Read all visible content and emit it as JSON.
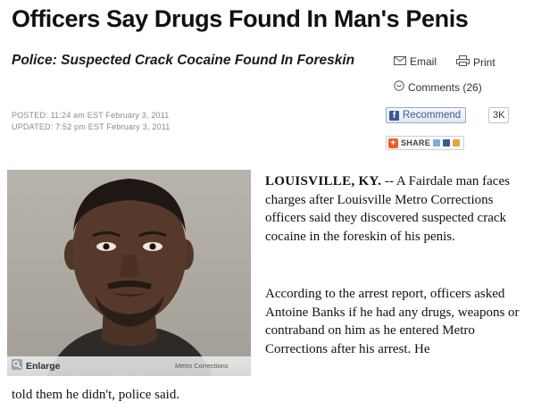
{
  "article": {
    "headline": "Officers Say Drugs Found In Man's Penis",
    "subheadline": "Police: Suspected Crack Cocaine Found In Foreskin",
    "posted": "POSTED: 11:24 am EST February 3, 2011",
    "updated": "UPDATED: 7:52 pm EST February 3, 2011",
    "dateline": "LOUISVILLE, KY.",
    "paragraph1_rest": " -- A Fairdale man faces charges after Louisville Metro Corrections officers said they discovered suspected crack cocaine in the foreskin of his penis.",
    "paragraph2": "According to the arrest report, officers asked Antoine Banks if he had any drugs, weapons or contraband on him as he entered Metro Corrections after his arrest. He",
    "paragraph2_continued": "told them he didn't, police said."
  },
  "tools": {
    "email_label": "Email",
    "print_label": "Print",
    "comments_label": "Comments (26)",
    "recommend_label": "Recommend",
    "recommend_count": "3K",
    "share_label": "SHARE",
    "icons": [
      "envelope-icon",
      "printer-icon",
      "comment-icon",
      "facebook-icon",
      "share-plus-icon"
    ]
  },
  "photo": {
    "enlarge_label": "Enlarge",
    "credit": "Metro Corrections"
  },
  "colors": {
    "facebook_blue": "#3b5998",
    "share_orange": "#e8622a",
    "meta_gray": "#8a8a8a"
  }
}
